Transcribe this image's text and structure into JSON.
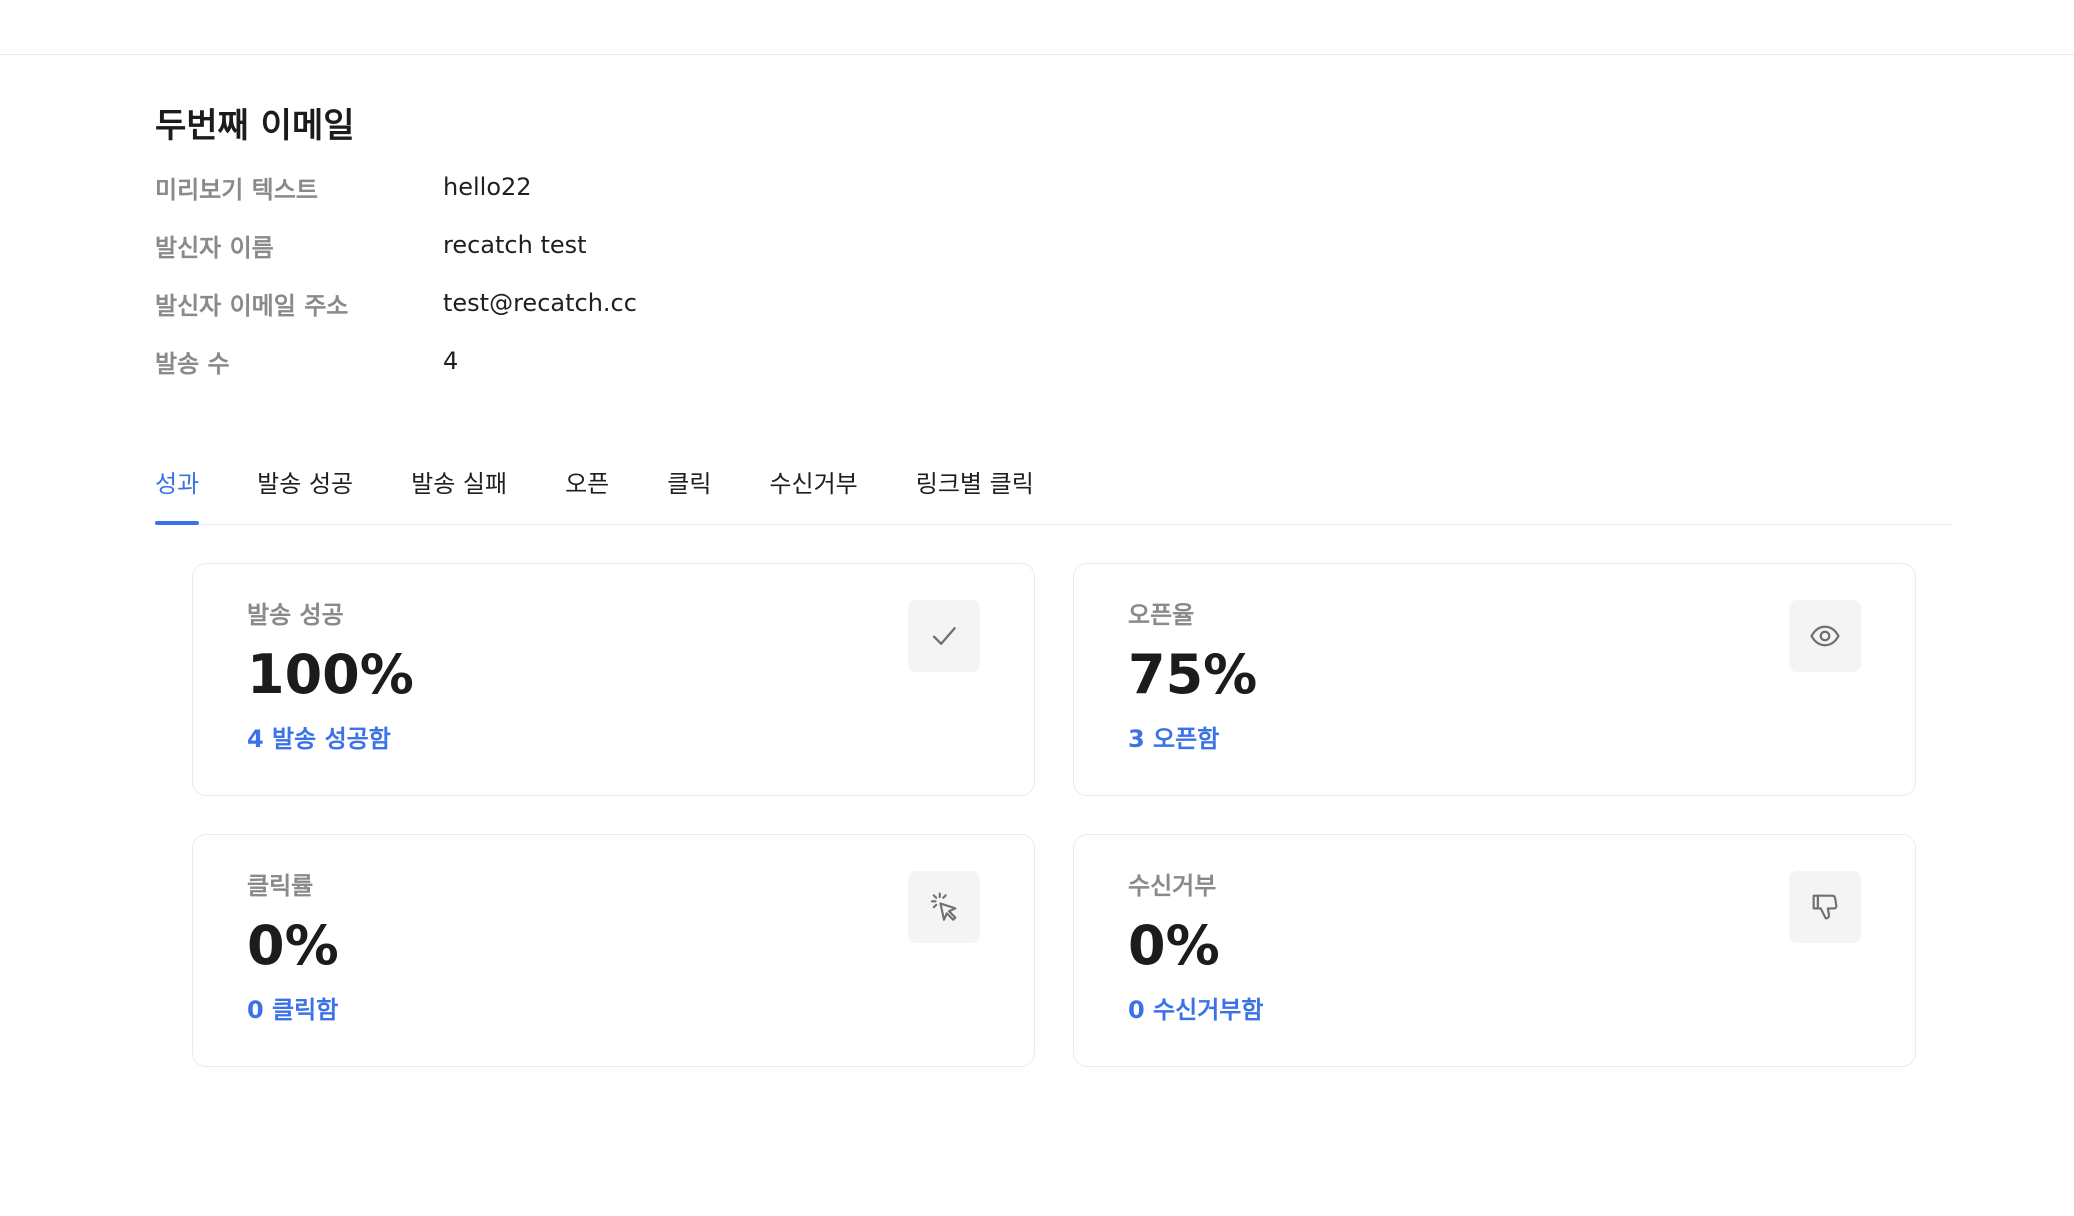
{
  "email": {
    "title": "두번째 이메일",
    "meta": [
      {
        "label": "미리보기 텍스트",
        "value": "hello22"
      },
      {
        "label": "발신자 이름",
        "value": "recatch test"
      },
      {
        "label": "발신자 이메일 주소",
        "value": "test@recatch.cc"
      },
      {
        "label": "발송 수",
        "value": "4"
      }
    ]
  },
  "tabs": [
    {
      "label": "성과",
      "active": true
    },
    {
      "label": "발송 성공"
    },
    {
      "label": "발송 실패"
    },
    {
      "label": "오픈"
    },
    {
      "label": "클릭"
    },
    {
      "label": "수신거부"
    },
    {
      "label": "링크별 클릭"
    }
  ],
  "cards": [
    {
      "label": "발송 성공",
      "value": "100%",
      "sub": "4 발송 성공함",
      "icon": "check-icon"
    },
    {
      "label": "오픈율",
      "value": "75%",
      "sub": "3 오픈함",
      "icon": "eye-icon"
    },
    {
      "label": "클릭률",
      "value": "0%",
      "sub": "0 클릭함",
      "icon": "cursor-click-icon"
    },
    {
      "label": "수신거부",
      "value": "0%",
      "sub": "0 수신거부함",
      "icon": "thumbs-down-icon"
    }
  ],
  "colors": {
    "accent": "#3b72e8",
    "muted": "#8a8a8a",
    "border": "#ebebeb",
    "icon_bg": "#f4f4f4"
  }
}
